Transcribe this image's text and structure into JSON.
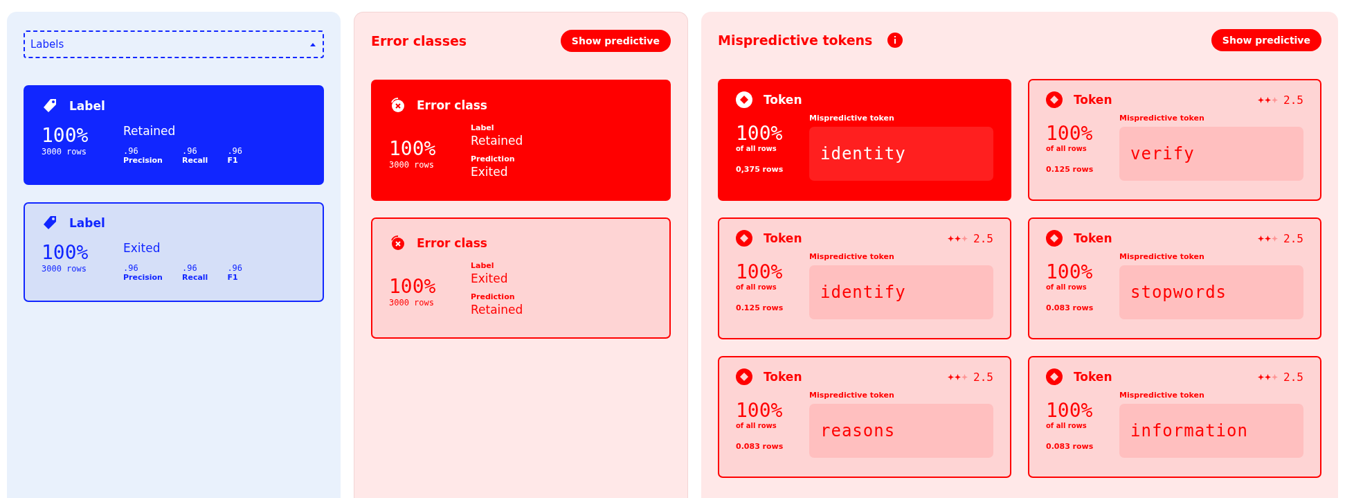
{
  "labels_panel": {
    "dropdown": {
      "value": "Labels",
      "expanded": true
    },
    "cards": [
      {
        "title": "Label",
        "selected": true,
        "percent": "100%",
        "rows": "3000 rows",
        "label": "Retained",
        "metrics": [
          {
            "value": ".96",
            "name": "Precision"
          },
          {
            "value": ".96",
            "name": "Recall"
          },
          {
            "value": ".96",
            "name": "F1"
          }
        ]
      },
      {
        "title": "Label",
        "selected": false,
        "percent": "100%",
        "rows": "3000 rows",
        "label": "Exited",
        "metrics": [
          {
            "value": ".96",
            "name": "Precision"
          },
          {
            "value": ".96",
            "name": "Recall"
          },
          {
            "value": ".96",
            "name": "F1"
          }
        ]
      }
    ]
  },
  "error_panel": {
    "title": "Error classes",
    "button": "Show predictive",
    "cards": [
      {
        "title": "Error class",
        "selected": true,
        "percent": "100%",
        "rows": "3000 rows",
        "fields": [
          {
            "name": "Label",
            "value": "Retained"
          },
          {
            "name": "Prediction",
            "value": "Exited"
          }
        ]
      },
      {
        "title": "Error class",
        "selected": false,
        "percent": "100%",
        "rows": "3000 rows",
        "fields": [
          {
            "name": "Label",
            "value": "Exited"
          },
          {
            "name": "Prediction",
            "value": "Retained"
          }
        ]
      }
    ]
  },
  "tokens_panel": {
    "title": "Mispredictive tokens",
    "button": "Show predictive",
    "cards": [
      {
        "title": "Token",
        "selected": true,
        "percent": "100%",
        "share": "of all rows",
        "rows": "0,375 rows",
        "caption": "Mispredictive token",
        "token": "identity"
      },
      {
        "title": "Token",
        "selected": false,
        "stars": 2,
        "score": "2.5",
        "percent": "100%",
        "share": "of all rows",
        "rows": "0.125 rows",
        "caption": "Mispredictive token",
        "token": "verify"
      },
      {
        "title": "Token",
        "selected": false,
        "stars": 2,
        "score": "2.5",
        "percent": "100%",
        "share": "of all rows",
        "rows": "0.125 rows",
        "caption": "Mispredictive token",
        "token": "identify"
      },
      {
        "title": "Token",
        "selected": false,
        "stars": 2,
        "score": "2.5",
        "percent": "100%",
        "share": "of all rows",
        "rows": "0.083 rows",
        "caption": "Mispredictive token",
        "token": "stopwords"
      },
      {
        "title": "Token",
        "selected": false,
        "stars": 2,
        "score": "2.5",
        "percent": "100%",
        "share": "of all rows",
        "rows": "0.083 rows",
        "caption": "Mispredictive token",
        "token": "reasons"
      },
      {
        "title": "Token",
        "selected": false,
        "stars": 2,
        "score": "2.5",
        "percent": "100%",
        "share": "of all rows",
        "rows": "0.083 rows",
        "caption": "Mispredictive token",
        "token": "information"
      }
    ]
  }
}
